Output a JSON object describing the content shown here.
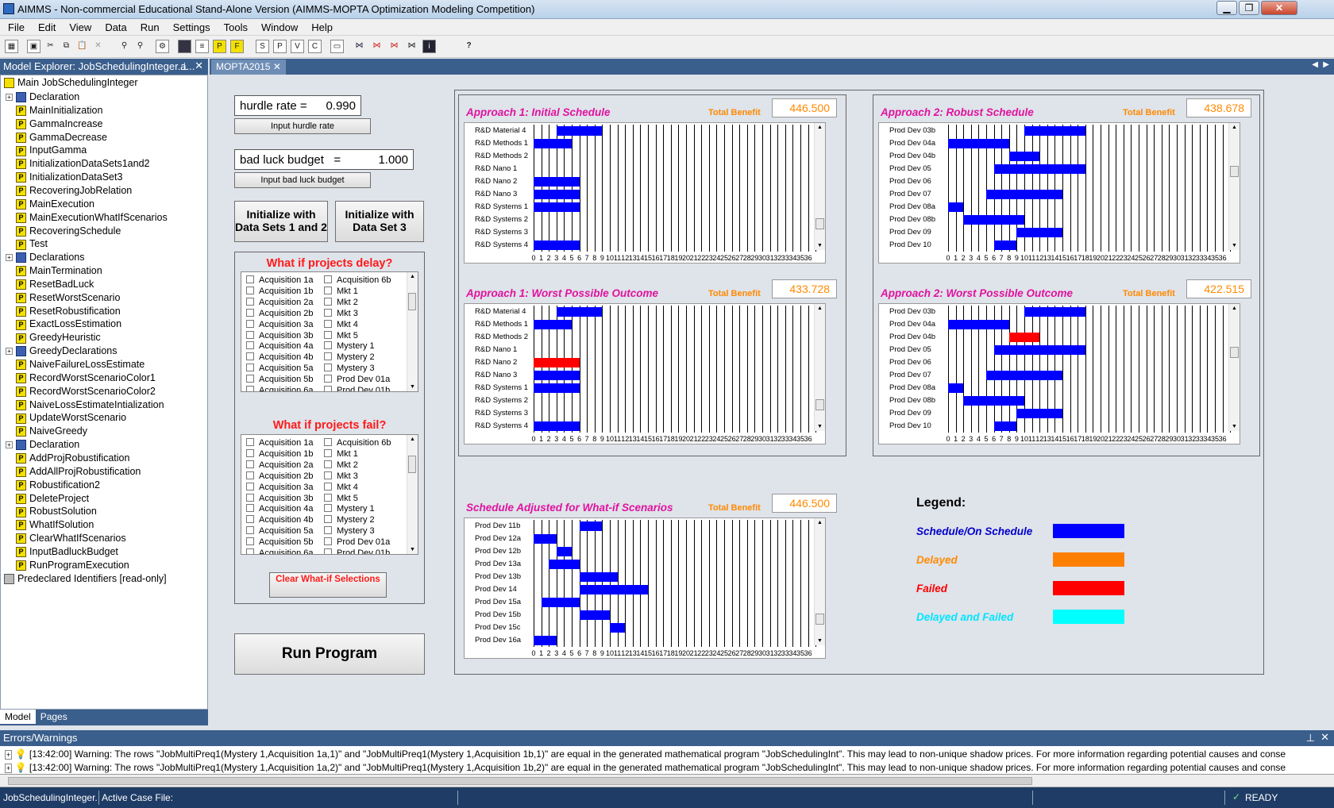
{
  "window": {
    "title": "AIMMS - Non-commercial Educational Stand-Alone Version (AIMMS-MOPTA Optimization Modeling Competition)"
  },
  "menu": [
    "File",
    "Edit",
    "View",
    "Data",
    "Run",
    "Settings",
    "Tools",
    "Window",
    "Help"
  ],
  "explorer": {
    "title": "Model Explorer: JobSchedulingInteger.a...",
    "root": "Main JobSchedulingInteger",
    "items": [
      {
        "label": "Declaration",
        "type": "decl",
        "expand": true
      },
      {
        "label": "MainInitialization",
        "type": "proc"
      },
      {
        "label": "GammaIncrease",
        "type": "proc"
      },
      {
        "label": "GammaDecrease",
        "type": "proc"
      },
      {
        "label": "InputGamma",
        "type": "proc"
      },
      {
        "label": "InitializationDataSets1and2",
        "type": "proc"
      },
      {
        "label": "InitializationDataSet3",
        "type": "proc"
      },
      {
        "label": "RecoveringJobRelation",
        "type": "proc"
      },
      {
        "label": "MainExecution",
        "type": "proc"
      },
      {
        "label": "MainExecutionWhatIfScenarios",
        "type": "proc"
      },
      {
        "label": "RecoveringSchedule",
        "type": "proc"
      },
      {
        "label": "Test",
        "type": "proc"
      },
      {
        "label": "Declarations",
        "type": "decl",
        "expand": true
      },
      {
        "label": "MainTermination",
        "type": "proc"
      },
      {
        "label": "ResetBadLuck",
        "type": "proc"
      },
      {
        "label": "ResetWorstScenario",
        "type": "proc"
      },
      {
        "label": "ResetRobustification",
        "type": "proc"
      },
      {
        "label": "ExactLossEstimation",
        "type": "proc"
      },
      {
        "label": "GreedyHeuristic",
        "type": "proc"
      },
      {
        "label": "GreedyDeclarations",
        "type": "decl",
        "expand": true
      },
      {
        "label": "NaiveFailureLossEstimate",
        "type": "proc"
      },
      {
        "label": "RecordWorstScenarioColor1",
        "type": "proc"
      },
      {
        "label": "RecordWorstScenarioColor2",
        "type": "proc"
      },
      {
        "label": "NaiveLossEstimateIntialization",
        "type": "proc"
      },
      {
        "label": "UpdateWorstScenario",
        "type": "proc"
      },
      {
        "label": "NaiveGreedy",
        "type": "proc"
      },
      {
        "label": "Declaration",
        "type": "decl",
        "expand": true
      },
      {
        "label": "AddProjRobustification",
        "type": "proc"
      },
      {
        "label": "AddAllProjRobustification",
        "type": "proc"
      },
      {
        "label": "Robustification2",
        "type": "proc"
      },
      {
        "label": "DeleteProject",
        "type": "proc"
      },
      {
        "label": "RobustSolution",
        "type": "proc"
      },
      {
        "label": "WhatIfSolution",
        "type": "proc"
      },
      {
        "label": "ClearWhatIfScenarios",
        "type": "proc"
      },
      {
        "label": "InputBadluckBudget",
        "type": "proc"
      },
      {
        "label": "RunProgramExecution",
        "type": "proc"
      }
    ],
    "predeclared": "Predeclared Identifiers [read-only]",
    "tabs": [
      "Model",
      "Pages"
    ]
  },
  "doc_tab": "MOPTA2015",
  "controls": {
    "hurdle_label": "hurdle rate  =",
    "hurdle_value": "0.990",
    "hurdle_button": "Input hurdle rate",
    "badluck_label": "bad luck budget   =",
    "badluck_value": "1.000",
    "badluck_button": "Input bad luck budget",
    "init12": "Initialize with Data Sets 1 and 2",
    "init3": "Initialize with Data Set 3",
    "delay_title": "What if projects delay?",
    "fail_title": "What if projects fail?",
    "clear_button": "Clear What-if Selections",
    "run_button": "Run Program",
    "checklist_left": [
      "Acquisition 1a",
      "Acquisition 1b",
      "Acquisition 2a",
      "Acquisition 2b",
      "Acquisition 3a",
      "Acquisition 3b",
      "Acquisition 4a",
      "Acquisition 4b",
      "Acquisition 5a",
      "Acquisition 5b",
      "Acquisition 6a"
    ],
    "checklist_right": [
      "Acquisition 6b",
      "Mkt 1",
      "Mkt 2",
      "Mkt 3",
      "Mkt 4",
      "Mkt 5",
      "Mystery 1",
      "Mystery 2",
      "Mystery 3",
      "Prod Dev 01a",
      "Prod Dev 01b"
    ]
  },
  "benefit_label": "Total Benefit",
  "x_ticks": [
    "0",
    "1",
    "2",
    "3",
    "4",
    "5",
    "6",
    "7",
    "8",
    "9",
    "10",
    "11",
    "12",
    "13",
    "14",
    "15",
    "16",
    "17",
    "18",
    "19",
    "20",
    "21",
    "22",
    "23",
    "24",
    "25",
    "26",
    "27",
    "28",
    "29",
    "30",
    "31",
    "32",
    "33",
    "34",
    "35",
    "36"
  ],
  "charts": [
    {
      "title": "Approach 1: Initial Schedule",
      "benefit": "446.500",
      "rows": [
        "R&D Material 4",
        "R&D Methods 1",
        "R&D Methods 2",
        "R&D Nano 1",
        "R&D Nano 2",
        "R&D Nano 3",
        "R&D Systems 1",
        "R&D Systems 2",
        "R&D Systems 3",
        "R&D Systems 4"
      ],
      "bars": [
        [
          0,
          3,
          9,
          "#0000ff"
        ],
        [
          1,
          0,
          5,
          "#0000ff"
        ],
        [
          4,
          0,
          6,
          "#0000ff"
        ],
        [
          5,
          0,
          6,
          "#0000ff"
        ],
        [
          6,
          0,
          6,
          "#0000ff"
        ],
        [
          9,
          0,
          6,
          "#0000ff"
        ]
      ]
    },
    {
      "title": "Approach 2: Robust Schedule",
      "benefit": "438.678",
      "rows": [
        "Prod Dev 03b",
        "Prod Dev 04a",
        "Prod Dev 04b",
        "Prod Dev 05",
        "Prod Dev 06",
        "Prod Dev 07",
        "Prod Dev 08a",
        "Prod Dev 08b",
        "Prod Dev 09",
        "Prod Dev 10"
      ],
      "bars": [
        [
          0,
          10,
          18,
          "#0000ff"
        ],
        [
          1,
          0,
          8,
          "#0000ff"
        ],
        [
          2,
          8,
          12,
          "#0000ff"
        ],
        [
          3,
          6,
          18,
          "#0000ff"
        ],
        [
          5,
          5,
          15,
          "#0000ff"
        ],
        [
          6,
          0,
          2,
          "#0000ff"
        ],
        [
          7,
          2,
          10,
          "#0000ff"
        ],
        [
          8,
          9,
          15,
          "#0000ff"
        ],
        [
          9,
          6,
          9,
          "#0000ff"
        ]
      ]
    },
    {
      "title": "Approach 1: Worst Possible Outcome",
      "benefit": "433.728",
      "rows": [
        "R&D Material 4",
        "R&D Methods 1",
        "R&D Methods 2",
        "R&D Nano 1",
        "R&D Nano 2",
        "R&D Nano 3",
        "R&D Systems 1",
        "R&D Systems 2",
        "R&D Systems 3",
        "R&D Systems 4"
      ],
      "bars": [
        [
          0,
          3,
          9,
          "#0000ff"
        ],
        [
          1,
          0,
          5,
          "#0000ff"
        ],
        [
          4,
          0,
          6,
          "#ff0000"
        ],
        [
          5,
          0,
          6,
          "#0000ff"
        ],
        [
          6,
          0,
          6,
          "#0000ff"
        ],
        [
          9,
          0,
          6,
          "#0000ff"
        ]
      ]
    },
    {
      "title": "Approach 2: Worst Possible Outcome",
      "benefit": "422.515",
      "rows": [
        "Prod Dev 03b",
        "Prod Dev 04a",
        "Prod Dev 04b",
        "Prod Dev 05",
        "Prod Dev 06",
        "Prod Dev 07",
        "Prod Dev 08a",
        "Prod Dev 08b",
        "Prod Dev 09",
        "Prod Dev 10"
      ],
      "bars": [
        [
          0,
          10,
          18,
          "#0000ff"
        ],
        [
          1,
          0,
          8,
          "#0000ff"
        ],
        [
          2,
          8,
          12,
          "#ff0000"
        ],
        [
          3,
          6,
          18,
          "#0000ff"
        ],
        [
          5,
          5,
          15,
          "#0000ff"
        ],
        [
          6,
          0,
          2,
          "#0000ff"
        ],
        [
          7,
          2,
          10,
          "#0000ff"
        ],
        [
          8,
          9,
          15,
          "#0000ff"
        ],
        [
          9,
          6,
          9,
          "#0000ff"
        ]
      ]
    },
    {
      "title": "Schedule Adjusted for What-if Scenarios",
      "benefit": "446.500",
      "rows": [
        "Prod Dev 11b",
        "Prod Dev 12a",
        "Prod Dev 12b",
        "Prod Dev 13a",
        "Prod Dev 13b",
        "Prod Dev 14",
        "Prod Dev 15a",
        "Prod Dev 15b",
        "Prod Dev 15c",
        "Prod Dev 16a"
      ],
      "bars": [
        [
          0,
          6,
          9,
          "#0000ff"
        ],
        [
          1,
          0,
          3,
          "#0000ff"
        ],
        [
          2,
          3,
          5,
          "#0000ff"
        ],
        [
          3,
          2,
          6,
          "#0000ff"
        ],
        [
          4,
          6,
          11,
          "#0000ff"
        ],
        [
          5,
          6,
          15,
          "#0000ff"
        ],
        [
          6,
          1,
          6,
          "#0000ff"
        ],
        [
          7,
          6,
          10,
          "#0000ff"
        ],
        [
          8,
          10,
          12,
          "#0000ff"
        ],
        [
          9,
          0,
          3,
          "#0000ff"
        ]
      ]
    }
  ],
  "legend": {
    "title": "Legend:",
    "items": [
      {
        "label": "Schedule/On Schedule",
        "text_color": "#0000cc",
        "color": "#0000ff"
      },
      {
        "label": "Delayed",
        "text_color": "#ff8a00",
        "color": "#ff8000"
      },
      {
        "label": "Failed",
        "text_color": "#ff0000",
        "color": "#ff0000"
      },
      {
        "label": "Delayed and Failed",
        "text_color": "#00e5ff",
        "color": "#00ffff"
      }
    ]
  },
  "errors": {
    "title": "Errors/Warnings",
    "lines": [
      "[13:42:00]  Warning: The rows \"JobMultiPreq1(Mystery 1,Acquisition 1a,1)\" and \"JobMultiPreq1(Mystery 1,Acquisition 1b,1)\" are equal in the generated mathematical program \"JobSchedulingInt\".  This may lead to non-unique shadow prices.  For more information regarding potential causes and conse",
      "[13:42:00]  Warning: The rows \"JobMultiPreq1(Mystery 1,Acquisition 1a,2)\" and \"JobMultiPreq1(Mystery 1,Acquisition 1b,2)\" are equal in the generated mathematical program \"JobSchedulingInt\".  This may lead to non-unique shadow prices.  For more information regarding potential causes and conse"
    ]
  },
  "status": {
    "project": "JobSchedulingInteger.",
    "case": "Active Case File:",
    "ready": "READY"
  }
}
